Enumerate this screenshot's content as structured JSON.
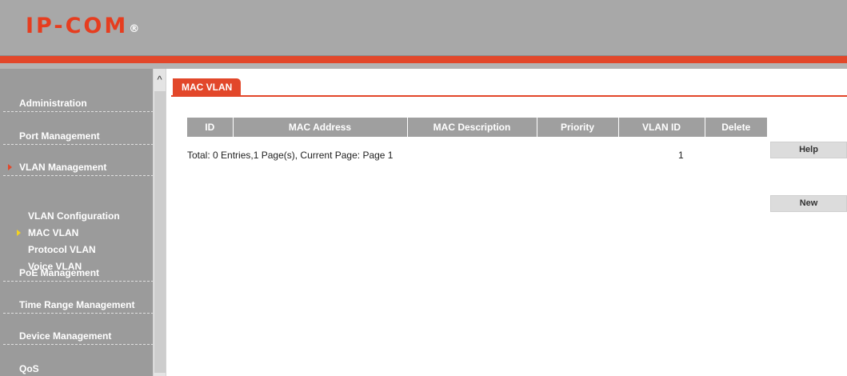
{
  "header": {
    "logo_text": "IP-COM",
    "logo_mark": "®",
    "colors": {
      "brand": "#e2472a",
      "header_bg": "#a8a8a8",
      "sidebar_bg": "#9b9b9b"
    }
  },
  "sidebar": {
    "items": [
      {
        "label": "Administration"
      },
      {
        "label": "Port Management"
      },
      {
        "label": "VLAN Management"
      },
      {
        "label": "PoE Management"
      },
      {
        "label": "Time Range Management"
      },
      {
        "label": "Device Management"
      },
      {
        "label": "QoS"
      }
    ],
    "sub_items": [
      {
        "label": "VLAN Configuration"
      },
      {
        "label": "MAC VLAN"
      },
      {
        "label": "Protocol VLAN"
      },
      {
        "label": "Voice VLAN"
      }
    ],
    "active_item": "VLAN Management",
    "active_sub_item": "MAC VLAN"
  },
  "scrollbar": {
    "up_glyph": "^"
  },
  "main": {
    "tab_label": "MAC VLAN",
    "table": {
      "columns": [
        "ID",
        "MAC Address",
        "MAC Description",
        "Priority",
        "VLAN ID",
        "Delete"
      ]
    },
    "total_text": "Total: 0 Entries,1 Page(s), Current Page: Page 1",
    "page_number": "1",
    "buttons": {
      "help": "Help",
      "new": "New"
    }
  }
}
